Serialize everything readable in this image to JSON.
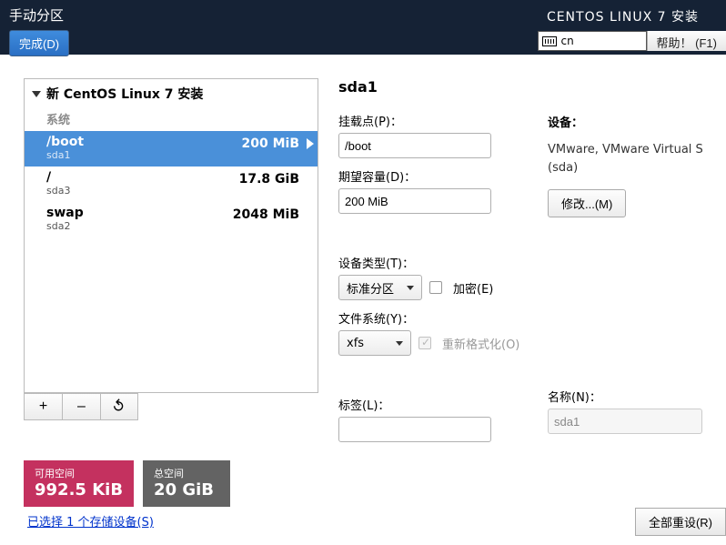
{
  "header": {
    "left_title": "手动分区",
    "done_label": "完成(D)",
    "right_title": "CENTOS LINUX 7 安装",
    "kb_layout": "cn",
    "help_label": "帮助！ (F1)"
  },
  "left": {
    "install_header": "新 CentOS Linux 7 安装",
    "group_label": "系统",
    "partitions": [
      {
        "name": "/boot",
        "dev": "sda1",
        "size": "200 MiB",
        "selected": true
      },
      {
        "name": "/",
        "dev": "sda3",
        "size": "17.8 GiB",
        "selected": false
      },
      {
        "name": "swap",
        "dev": "sda2",
        "size": "2048 MiB",
        "selected": false
      }
    ],
    "toolbar": {
      "add": "+",
      "remove": "–",
      "reload": "↻"
    }
  },
  "space": {
    "avail_label": "可用空间",
    "avail_value": "992.5 KiB",
    "total_label": "总空间",
    "total_value": "20 GiB"
  },
  "storage_link": "已选择 1 个存储设备(S)",
  "reset_label": "全部重设(R)",
  "details": {
    "heading": "sda1",
    "mount_label": "挂载点(P)：",
    "mount_value": "/boot",
    "capacity_label": "期望容量(D)：",
    "capacity_value": "200 MiB",
    "devtype_label": "设备类型(T)：",
    "devtype_value": "标准分区",
    "encrypt_label": "加密(E)",
    "fs_label": "文件系统(Y)：",
    "fs_value": "xfs",
    "reformat_label": "重新格式化(O)",
    "tag_label": "标签(L)：",
    "tag_value": "",
    "device_header": "设备：",
    "device_value": "VMware, VMware Virtual S (sda)",
    "modify_label": "修改...(M)",
    "name_label": "名称(N)：",
    "name_value": "sda1"
  }
}
